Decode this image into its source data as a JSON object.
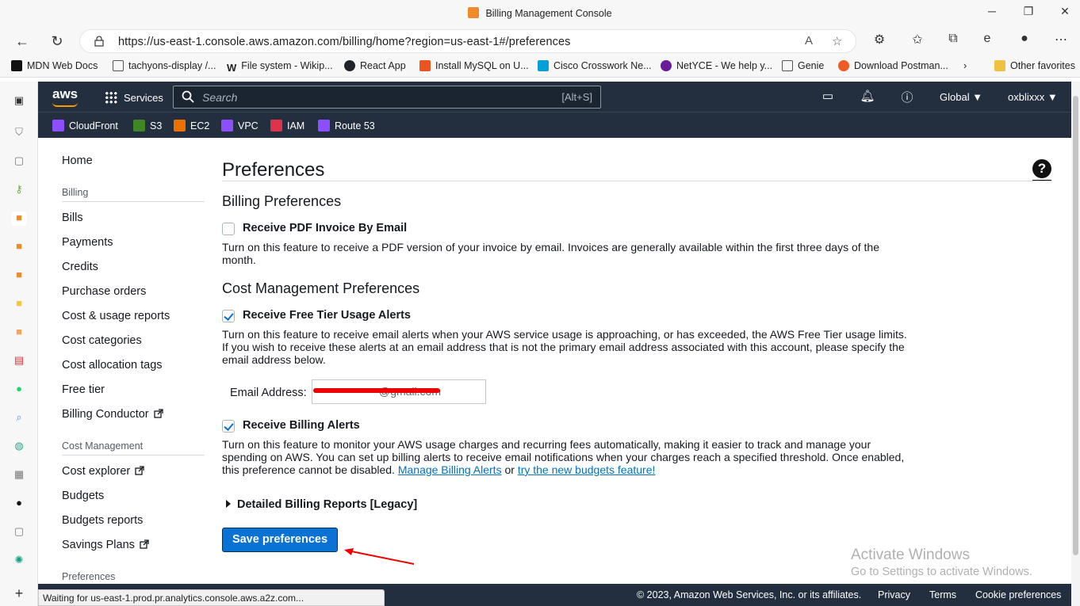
{
  "window": {
    "title": "Billing Management Console"
  },
  "browser": {
    "url": "https://us-east-1.console.aws.amazon.com/billing/home?region=us-east-1#/preferences",
    "bookmarks": [
      "MDN Web Docs",
      "tachyons-display /...",
      "File system - Wikip...",
      "React App",
      "Install MySQL on U...",
      "Cisco Crosswork Ne...",
      "NetYCE - We help y...",
      "Genie",
      "Download Postman...",
      "Other favorites"
    ],
    "status_text": "Waiting for us-east-1.prod.pr.analytics.console.aws.a2z.com..."
  },
  "aws_header": {
    "logo": "aws",
    "services_label": "Services",
    "search_placeholder": "Search",
    "search_shortcut": "[Alt+S]",
    "region": "Global ▼",
    "account": "oxblixxx ▼",
    "favorites": [
      "CloudFront",
      "S3",
      "EC2",
      "VPC",
      "IAM",
      "Route 53"
    ]
  },
  "leftnav": {
    "home": "Home",
    "billing_section": "Billing",
    "billing_items": [
      "Bills",
      "Payments",
      "Credits",
      "Purchase orders",
      "Cost & usage reports",
      "Cost categories",
      "Cost allocation tags",
      "Free tier",
      "Billing Conductor"
    ],
    "cost_section": "Cost Management",
    "cost_items": [
      "Cost explorer",
      "Budgets",
      "Budgets reports",
      "Savings Plans"
    ],
    "preferences_section": "Preferences"
  },
  "main": {
    "title": "Preferences",
    "help": "?",
    "billing_prefs_heading": "Billing Preferences",
    "pdf_invoice_label": "Receive PDF Invoice By Email",
    "pdf_invoice_checked": false,
    "pdf_invoice_desc": "Turn on this feature to receive a PDF version of your invoice by email. Invoices are generally available within the first three days of the month.",
    "cost_mgmt_heading": "Cost Management Preferences",
    "free_tier_label": "Receive Free Tier Usage Alerts",
    "free_tier_checked": true,
    "free_tier_desc": "Turn on this feature to receive email alerts when your AWS service usage is approaching, or has exceeded, the AWS Free Tier usage limits. If you wish to receive these alerts at an email address that is not the primary email address associated with this account, please specify the email address below.",
    "email_label": "Email Address:",
    "email_value": "@gmail.com",
    "billing_alerts_label": "Receive Billing Alerts",
    "billing_alerts_checked": true,
    "billing_alerts_desc": "Turn on this feature to monitor your AWS usage charges and recurring fees automatically, making it easier to track and manage your spending on AWS. You can set up billing alerts to receive email notifications when your charges reach a specified threshold. Once enabled, this preference cannot be disabled.",
    "manage_alerts_link": "Manage Billing Alerts",
    "or_text": "or",
    "budgets_link": "try the new budgets feature!",
    "detailed_reports": "Detailed Billing Reports [Legacy]",
    "save_button": "Save preferences"
  },
  "watermark": {
    "line1": "Activate Windows",
    "line2": "Go to Settings to activate Windows."
  },
  "footer": {
    "copyright": "© 2023, Amazon Web Services, Inc. or its affiliates.",
    "privacy": "Privacy",
    "terms": "Terms",
    "cookies": "Cookie preferences"
  }
}
